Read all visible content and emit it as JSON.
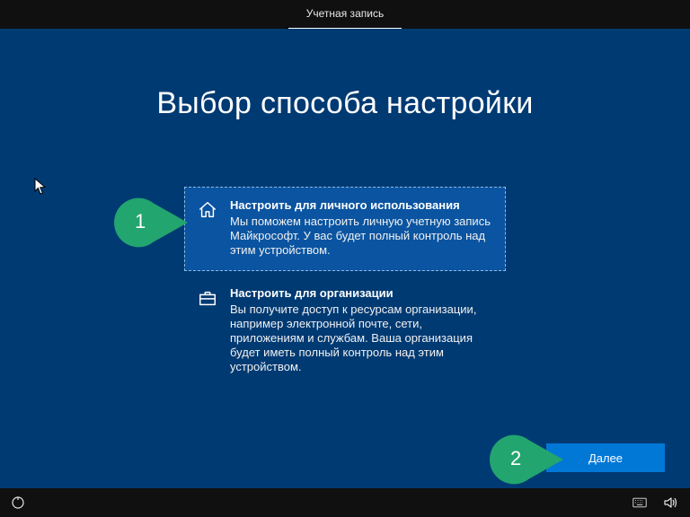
{
  "header": {
    "active_tab": "Учетная запись"
  },
  "page": {
    "title": "Выбор способа настройки",
    "next_label": "Далее"
  },
  "options": {
    "personal": {
      "title": "Настроить для личного использования",
      "desc": "Мы поможем настроить личную учетную запись Майкрософт. У вас будет полный контроль над этим устройством.",
      "icon": "home-icon",
      "selected": true
    },
    "organization": {
      "title": "Настроить для организации",
      "desc": "Вы получите доступ к ресурсам организации, например электронной почте, сети, приложениям и службам. Ваша организация будет иметь полный контроль над этим устройством.",
      "icon": "briefcase-icon",
      "selected": false
    }
  },
  "callouts": {
    "one": "1",
    "two": "2"
  }
}
